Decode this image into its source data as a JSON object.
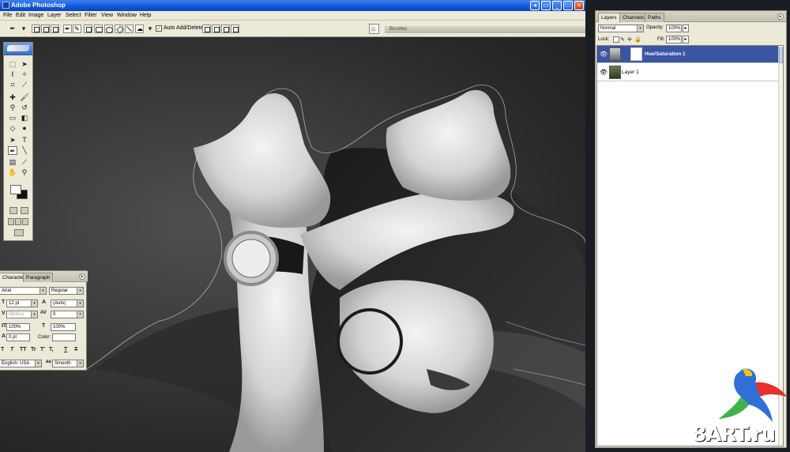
{
  "window": {
    "title": "Adobe Photoshop"
  },
  "menu": [
    "File",
    "Edit",
    "Image",
    "Layer",
    "Select",
    "Filter",
    "View",
    "Window",
    "Help"
  ],
  "options_bar": {
    "auto_add_delete_label": "Auto Add/Delete",
    "auto_add_delete_checked": true,
    "palette_well_tab": "Brushes"
  },
  "character_panel": {
    "tabs": [
      "Character",
      "Paragraph"
    ],
    "font_family": "Arial",
    "font_style": "Regular",
    "font_size": "12 pt",
    "leading": "(Auto)",
    "kerning": "Metrics",
    "tracking": "0",
    "vertical_scale": "100%",
    "horizontal_scale": "100%",
    "baseline_shift": "0 pt",
    "color_label": "Color:",
    "style_buttons": [
      "T",
      "T",
      "TT",
      "Tr",
      "T'",
      "T,",
      "T",
      "T"
    ],
    "language": "English: USA",
    "antialias_icon_label": "a",
    "antialias": "Smooth"
  },
  "layers_panel": {
    "tabs": [
      "Layers",
      "Channels",
      "Paths"
    ],
    "blend_mode": "Normal",
    "opacity_label": "Opacity:",
    "opacity": "100%",
    "lock_label": "Lock:",
    "fill_label": "Fill:",
    "fill": "100%",
    "layers": [
      {
        "name": "Hue/Saturation 1",
        "selected": true,
        "visible": true,
        "type": "adjustment"
      },
      {
        "name": "Layer 1",
        "selected": false,
        "visible": true,
        "type": "pixel"
      }
    ]
  },
  "watermark": {
    "text": "8ART.ru"
  },
  "colors": {
    "title_blue": "#0f56d8",
    "chrome": "#ece9d8",
    "layer_selected": "#3a55a3"
  }
}
